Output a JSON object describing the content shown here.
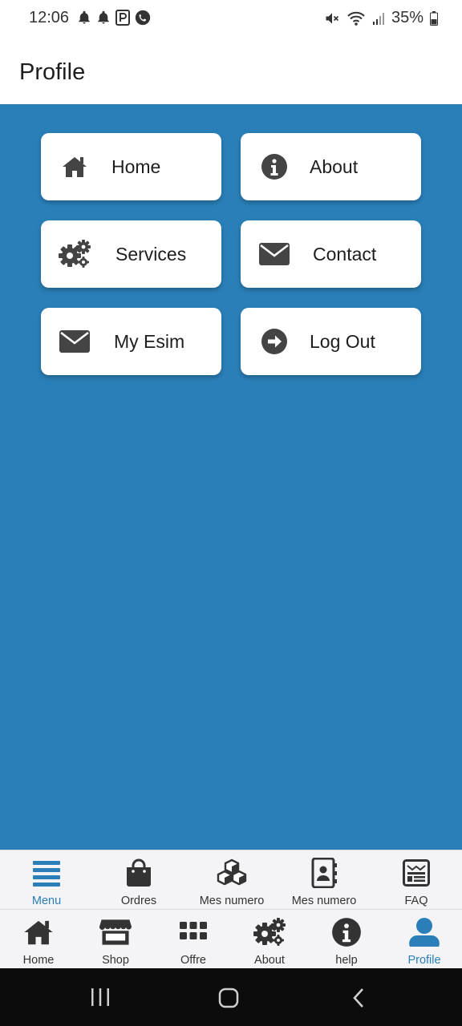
{
  "status": {
    "time": "12:06",
    "battery": "35%"
  },
  "header": {
    "title": "Profile"
  },
  "menu": [
    {
      "label": "Home",
      "icon": "home-icon"
    },
    {
      "label": "About",
      "icon": "info-circle-icon"
    },
    {
      "label": "Services",
      "icon": "gears-icon"
    },
    {
      "label": "Contact",
      "icon": "envelope-icon"
    },
    {
      "label": "My Esim",
      "icon": "envelope-icon"
    },
    {
      "label": "Log Out",
      "icon": "arrow-circle-right-icon"
    }
  ],
  "tabs_top": [
    {
      "label": "Menu",
      "icon": "menu-icon",
      "active": true
    },
    {
      "label": "Ordres",
      "icon": "shopping-bag-icon"
    },
    {
      "label": "Mes numero",
      "icon": "cubes-icon"
    },
    {
      "label": "Mes numero",
      "icon": "address-book-icon"
    },
    {
      "label": "FAQ",
      "icon": "newspaper-icon"
    }
  ],
  "tabs_bottom": [
    {
      "label": "Home",
      "icon": "home-icon"
    },
    {
      "label": "Shop",
      "icon": "store-icon"
    },
    {
      "label": "Offre",
      "icon": "grid-icon"
    },
    {
      "label": "About",
      "icon": "gears-icon"
    },
    {
      "label": "help",
      "icon": "info-circle-icon"
    },
    {
      "label": "Profile",
      "icon": "user-icon",
      "active": true
    }
  ],
  "colors": {
    "accent": "#2a7fb8",
    "icon": "#444444",
    "card": "#ffffff"
  }
}
